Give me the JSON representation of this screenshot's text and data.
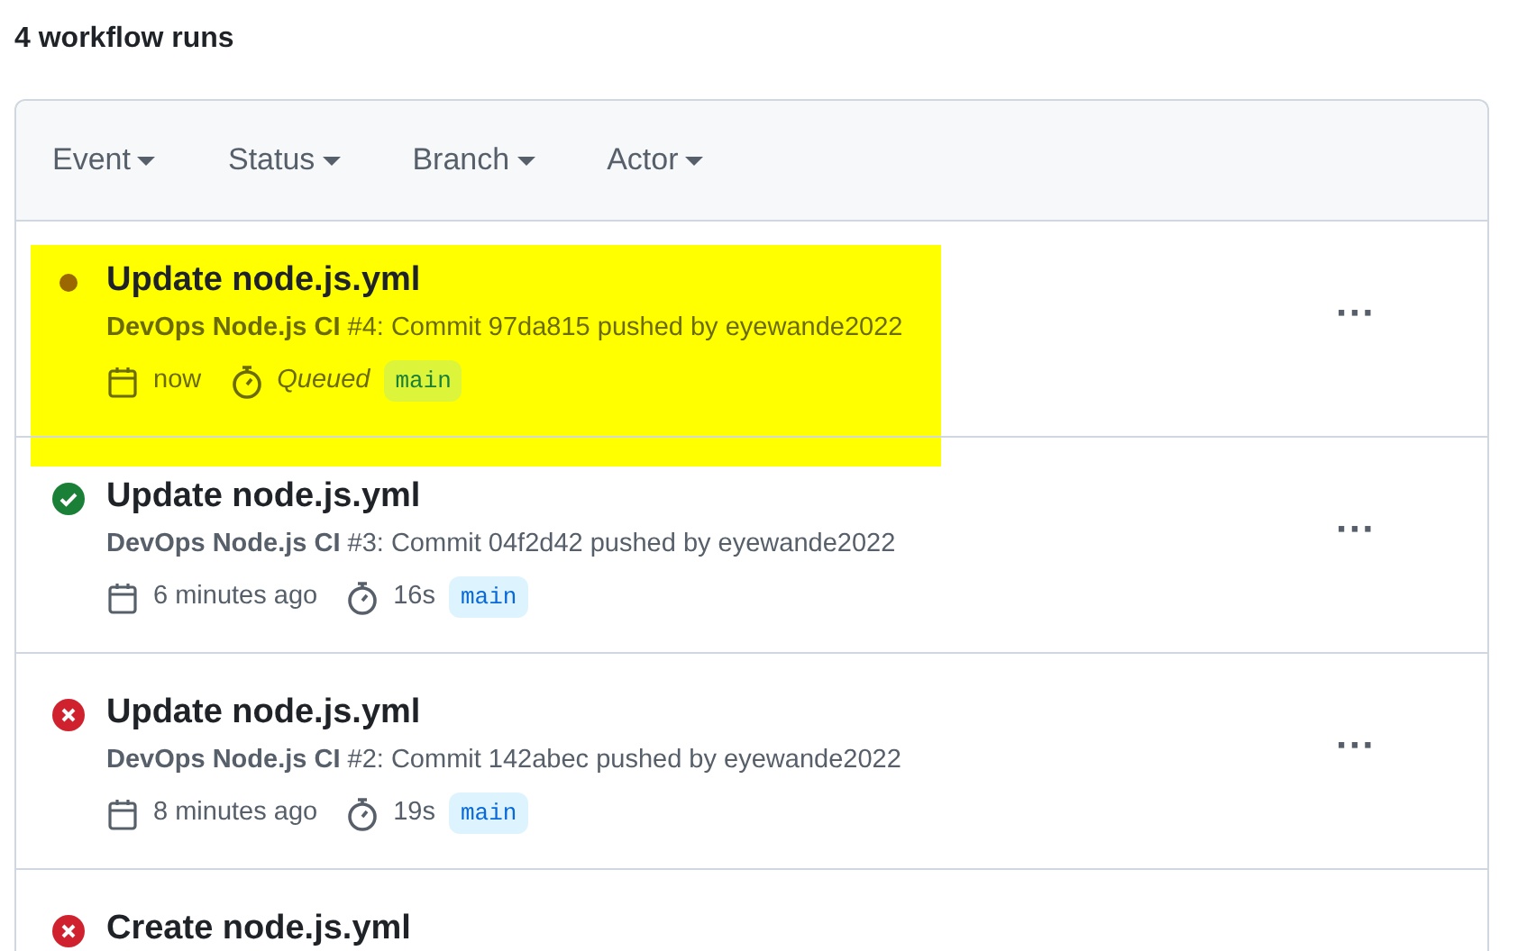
{
  "heading": "4 workflow runs",
  "filters": [
    "Event",
    "Status",
    "Branch",
    "Actor"
  ],
  "runs": [
    {
      "kind": "queued",
      "highlighted": true,
      "title": "Update node.js.yml",
      "workflow": "DevOps Node.js CI",
      "description": "#4: Commit 97da815 pushed by eyewande2022",
      "time": "now",
      "duration": "Queued",
      "branch": "main",
      "menu": "···"
    },
    {
      "kind": "success",
      "highlighted": false,
      "title": "Update node.js.yml",
      "workflow": "DevOps Node.js CI",
      "description": "#3: Commit 04f2d42 pushed by eyewande2022",
      "time": "6 minutes ago",
      "duration": "16s",
      "branch": "main",
      "menu": "···"
    },
    {
      "kind": "failure",
      "highlighted": false,
      "title": "Update node.js.yml",
      "workflow": "DevOps Node.js CI",
      "description": "#2: Commit 142abec pushed by eyewande2022",
      "time": "8 minutes ago",
      "duration": "19s",
      "branch": "main",
      "menu": "···"
    },
    {
      "kind": "failure",
      "highlighted": false,
      "title": "Create node.js.yml"
    }
  ]
}
